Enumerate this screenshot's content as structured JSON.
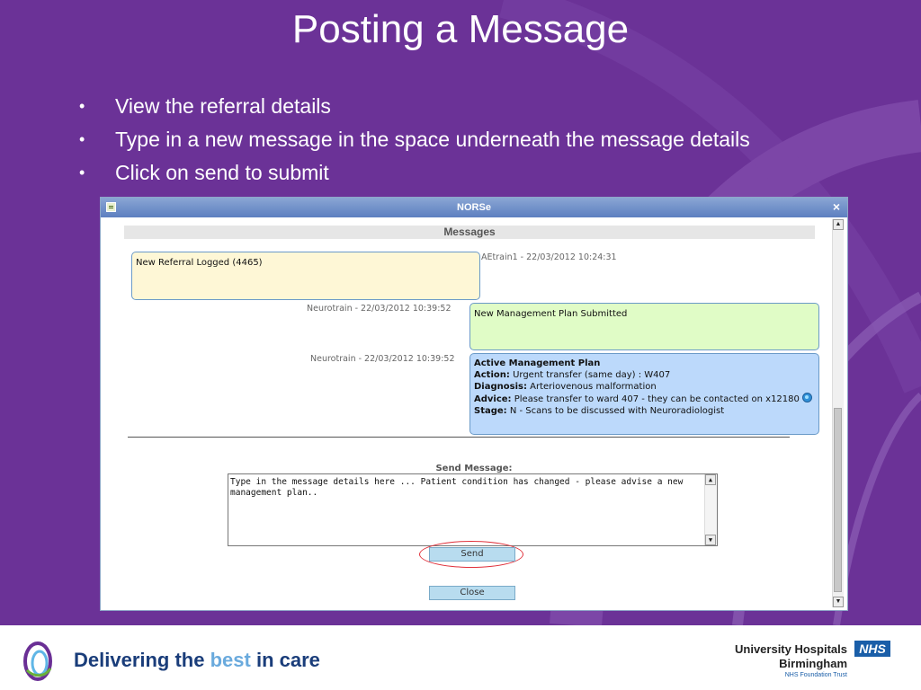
{
  "slide": {
    "title": "Posting a Message",
    "bullets": [
      "View the referral details",
      "Type in a new message in the space underneath the message details",
      "Click on send to submit"
    ]
  },
  "window": {
    "title": "NORSe",
    "close_glyph": "×",
    "messages_header": "Messages",
    "messages": [
      {
        "text": "New Referral Logged (4465)",
        "stamp": "AEtrain1 - 22/03/2012 10:24:31"
      },
      {
        "text": "New Management Plan Submitted",
        "stamp": "Neurotrain - 22/03/2012 10:39:52"
      },
      {
        "stamp": "Neurotrain - 22/03/2012 10:39:52",
        "heading": "Active Management Plan",
        "action_label": "Action:",
        "action_value": "Urgent transfer (same day) : W407",
        "diagnosis_label": "Diagnosis:",
        "diagnosis_value": "Arteriovenous malformation",
        "advice_label": "Advice:",
        "advice_value": "Please transfer to ward 407 - they can be contacted on x12180",
        "stage_label": "Stage:",
        "stage_value": "N - Scans to be discussed with Neuroradiologist"
      }
    ],
    "send_message_label": "Send Message:",
    "message_text": "Type in the message details here ... Patient condition has changed - please advise a new management plan..",
    "send_button": "Send",
    "close_button": "Close"
  },
  "footer": {
    "tagline_a": "Delivering the",
    "tagline_b": "best",
    "tagline_c": "in care",
    "org_line1": "University Hospitals",
    "org_line2": "Birmingham",
    "org_line3": "NHS Foundation Trust",
    "nhs": "NHS"
  },
  "colors": {
    "slide_bg": "#6b3297",
    "titlebar": "#5d7fc0",
    "brand_blue": "#1a5ea8"
  }
}
